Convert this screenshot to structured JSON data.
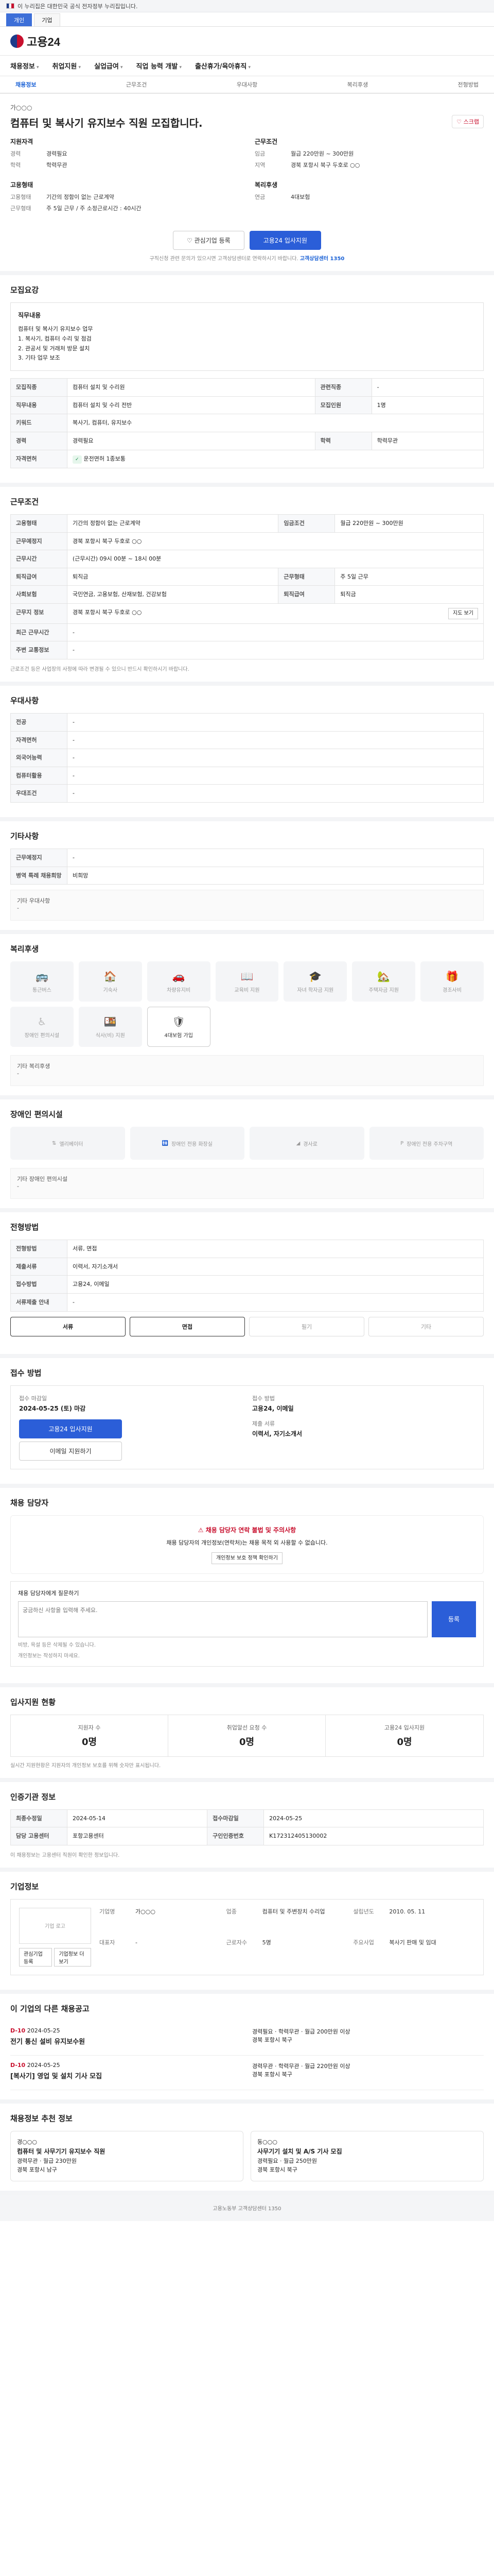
{
  "gov_bar": {
    "text": "이 누리집은 대한민국 공식 전자정부 누리집입니다."
  },
  "top_tabs": [
    "개인",
    "기업"
  ],
  "logo": {
    "text": "고용24"
  },
  "gnb": [
    "채용정보",
    "취업지원",
    "실업급여",
    "직업 능력 개발",
    "출산휴가/육아휴직"
  ],
  "subtabs": [
    "채용정보",
    "근무조건",
    "우대사항",
    "복리후생",
    "전형방법"
  ],
  "summary": {
    "company": "가○○○",
    "title": "컴퓨터 및 복사기 유지보수 직원 모집합니다.",
    "scrap": "스크랩",
    "qualification": {
      "heading": "지원자격",
      "rows": [
        {
          "k": "경력",
          "v": "경력필요"
        },
        {
          "k": "학력",
          "v": "학력무관"
        }
      ]
    },
    "conditions": {
      "heading": "근무조건",
      "rows": [
        {
          "k": "임금",
          "v": "월급 220만원 ~ 300만원"
        },
        {
          "k": "지역",
          "v": "경북 포항시 북구 두호로 ○○"
        }
      ]
    },
    "employment": {
      "heading": "고용형태",
      "rows": [
        {
          "k": "고용형태",
          "v": "기간의 정함이 없는 근로계약"
        },
        {
          "k": "근무형태",
          "v": "주 5일 근무 / 주 소정근로시간 : 40시간"
        }
      ]
    },
    "extra": {
      "heading": "복리후생",
      "rows": [
        {
          "k": "연금",
          "v": "4대보험"
        }
      ]
    },
    "btn_interest": "관심기업 등록",
    "btn_apply": "고용24 입사지원",
    "notice": "구직신청 관련 문의가 있으시면 고객상담센터로 연락하시기 바랍니다.",
    "notice_link": "고객상담센터 1350"
  },
  "recruit": {
    "heading": "모집요강",
    "duty_title": "직무내용",
    "duty_lines": [
      "컴퓨터 및 복사기 유지보수 업무",
      "1. 복사기, 컴퓨터 수리 및 점검",
      "2. 관공서 및 거래처 방문 설치",
      "3. 기타 업무 보조"
    ],
    "table": [
      {
        "k": "모집직종",
        "v": "컴퓨터 설치 및 수리원",
        "k2": "관련직종",
        "v2": "-"
      },
      {
        "k": "직무내용",
        "v": "컴퓨터 설치 및 수리 전반",
        "k2": "모집인원",
        "v2": "1명"
      },
      {
        "k": "키워드",
        "v": "복사기, 컴퓨터, 유지보수",
        "k2": "",
        "v2": ""
      },
      {
        "k": "경력",
        "v": "경력필요",
        "k2": "학력",
        "v2": "학력무관"
      },
      {
        "k": "자격면허",
        "v": "운전면허 1종보통",
        "k2": "",
        "v2": ""
      }
    ]
  },
  "work": {
    "heading": "근무조건",
    "table": [
      {
        "k": "고용형태",
        "v": "기간의 정함이 없는 근로계약",
        "k2": "임금조건",
        "v2": "월급 220만원 ~ 300만원"
      },
      {
        "k": "근무예정지",
        "v": "경북 포항시 북구 두호로 ○○",
        "k2": "",
        "v2": ""
      },
      {
        "k": "근무시간",
        "v": "(근무시간) 09시 00분 ~ 18시 00분",
        "k2": "",
        "v2": ""
      },
      {
        "k": "퇴직급여",
        "v": "퇴직금",
        "k2": "근무형태",
        "v2": "주 5일 근무"
      },
      {
        "k": "사회보험",
        "v": "국민연금, 고용보험, 산재보험, 건강보험",
        "k2": "퇴직급여",
        "v2": "퇴직금"
      },
      {
        "k": "근무지 정보",
        "v": "경북 포항시 북구 두호로 ○○",
        "k2": "",
        "v2": ""
      },
      {
        "k": "최근 근무시간",
        "v": "-",
        "k2": "",
        "v2": ""
      },
      {
        "k": "주변 교통정보",
        "v": "-",
        "k2": "",
        "v2": ""
      }
    ],
    "map_btn": "지도 보기",
    "note": "근로조건 등은 사업장의 사정에 따라 변경될 수 있으니 반드시 확인하시기 바랍니다."
  },
  "preference": {
    "heading": "우대사항",
    "table": [
      {
        "k": "전공",
        "v": "-"
      },
      {
        "k": "자격면허",
        "v": "-"
      },
      {
        "k": "외국어능력",
        "v": "-"
      },
      {
        "k": "컴퓨터활용",
        "v": "-"
      },
      {
        "k": "우대조건",
        "v": "-"
      }
    ]
  },
  "etc": {
    "heading": "기타사항",
    "table": [
      {
        "k": "근무예정지",
        "v": "-"
      },
      {
        "k": "병역 특례 채용희망",
        "v": "비희망"
      }
    ],
    "extra_title": "기타 우대사항",
    "extra_value": "-"
  },
  "welfare": {
    "heading": "복리후생",
    "items": [
      {
        "label": "통근버스",
        "icon": "🚌",
        "on": false
      },
      {
        "label": "기숙사",
        "icon": "🏠",
        "on": false
      },
      {
        "label": "차량유지비",
        "icon": "🚗",
        "on": false
      },
      {
        "label": "교육비 지원",
        "icon": "📖",
        "on": false
      },
      {
        "label": "자녀 학자금 지원",
        "icon": "🎓",
        "on": false
      },
      {
        "label": "주택자금 지원",
        "icon": "🏡",
        "on": false
      },
      {
        "label": "경조사비",
        "icon": "🎁",
        "on": false
      },
      {
        "label": "장애인 편의시설",
        "icon": "♿",
        "on": false
      },
      {
        "label": "식사(비) 지원",
        "icon": "🍱",
        "on": false
      },
      {
        "label": "4대보험 가입",
        "icon": "🛡",
        "on": true
      }
    ],
    "other_title": "기타 복리후생",
    "other_value": "-"
  },
  "disability": {
    "heading": "장애인 편의시설",
    "items": [
      "엘리베이터",
      "장애인 전용 화장실",
      "경사로",
      "장애인 전용 주차구역"
    ],
    "other_title": "기타 장애인 편의시설",
    "other_value": "-"
  },
  "apply_method": {
    "heading": "전형방법",
    "table": [
      {
        "k": "전형방법",
        "v": "서류, 면접"
      },
      {
        "k": "제출서류",
        "v": "이력서, 자기소개서"
      },
      {
        "k": "접수방법",
        "v": "고용24, 이메일"
      },
      {
        "k": "서류제출 안내",
        "v": "-"
      }
    ],
    "chips": [
      {
        "label": "서류",
        "on": true
      },
      {
        "label": "면접",
        "on": true
      },
      {
        "label": "필기",
        "on": false
      },
      {
        "label": "기타",
        "on": false
      }
    ]
  },
  "apply": {
    "heading": "접수 방법",
    "deadline_label": "접수 마감일",
    "deadline": "2024-05-25 (토) 마감",
    "method_label": "접수 방법",
    "method": "고용24, 이메일",
    "btn_apply": "고용24 입사지원",
    "btn_email": "이메일 지원하기",
    "doc_label": "제출 서류",
    "doc": "이력서, 자기소개서"
  },
  "contact": {
    "heading": "채용 담당자",
    "warn_title": "채용 담당자 연락 불법 및 주의사항",
    "warn_text": "채용 담당자의 개인정보(연락처)는 채용 목적 외 사용할 수 없습니다.",
    "warn_link": "개인정보 보호 정책 확인하기",
    "q_title": "채용 담당자에게 질문하기",
    "q_placeholder": "궁금하신 사항을 입력해 주세요.",
    "q_send": "등록",
    "q_notes": [
      "비방, 욕설 등은 삭제될 수 있습니다.",
      "개인정보는 작성하지 마세요."
    ]
  },
  "stats": {
    "heading": "입사지원 현황",
    "items": [
      {
        "label": "지원자 수",
        "value": "0명"
      },
      {
        "label": "취업알선 요청 수",
        "value": "0명"
      },
      {
        "label": "고용24 입사지원",
        "value": "0명"
      }
    ],
    "note": "실시간 지원현황은 지원자의 개인정보 보호를 위해 숫자만 표시됩니다."
  },
  "posting": {
    "heading": "인증기관 정보",
    "table": [
      {
        "k": "최종수정일",
        "v": "2024-05-14",
        "k2": "접수마감일",
        "v2": "2024-05-25"
      },
      {
        "k": "담당 고용센터",
        "v": "포항고용센터",
        "k2": "구인인증번호",
        "v2": "K172312405130002"
      }
    ],
    "note": "이 채용정보는 고용센터 직원이 확인한 정보입니다."
  },
  "company": {
    "heading": "기업정보",
    "logo_alt": "기업 로고",
    "rows": [
      {
        "k": "기업명",
        "v": "가○○○"
      },
      {
        "k": "업종",
        "v": "컴퓨터 및 주변장치 수리업"
      },
      {
        "k": "설립년도",
        "v": "2010. 05. 11"
      },
      {
        "k": "대표자",
        "v": "-"
      },
      {
        "k": "근로자수",
        "v": "5명"
      },
      {
        "k": "주요사업",
        "v": "복사기 판매 및 임대"
      }
    ],
    "btn_interest": "관심기업 등록",
    "btn_more": "기업정보 더보기"
  },
  "same_company": {
    "heading": "이 기업의 다른 채용공고",
    "jobs": [
      {
        "dday": "D-10",
        "date": "2024-05-25",
        "title": "전기 통신 설비 유지보수원",
        "cond": "경력필요 · 학력무관 · 월급 200만원 이상",
        "place": "경북 포항시 북구"
      },
      {
        "dday": "D-10",
        "date": "2024-05-25",
        "title": "[복사기] 영업 및 설치 기사 모집",
        "cond": "경력무관 · 학력무관 · 월급 220만원 이상",
        "place": "경북 포항시 북구"
      }
    ]
  },
  "recommend": {
    "heading": "채용정보 추천 정보",
    "cards": [
      {
        "company": "경○○○",
        "title": "컴퓨터 및 사무기기 유지보수 직원",
        "cond": "경력무관 · 월급 230만원",
        "place": "경북 포항시 남구"
      },
      {
        "company": "동○○○",
        "title": "사무기기 설치 및 A/S 기사 모집",
        "cond": "경력필요 · 월급 250만원",
        "place": "경북 포항시 북구"
      }
    ]
  },
  "footer": {
    "text": "고용노동부 고객상담센터 1350"
  }
}
